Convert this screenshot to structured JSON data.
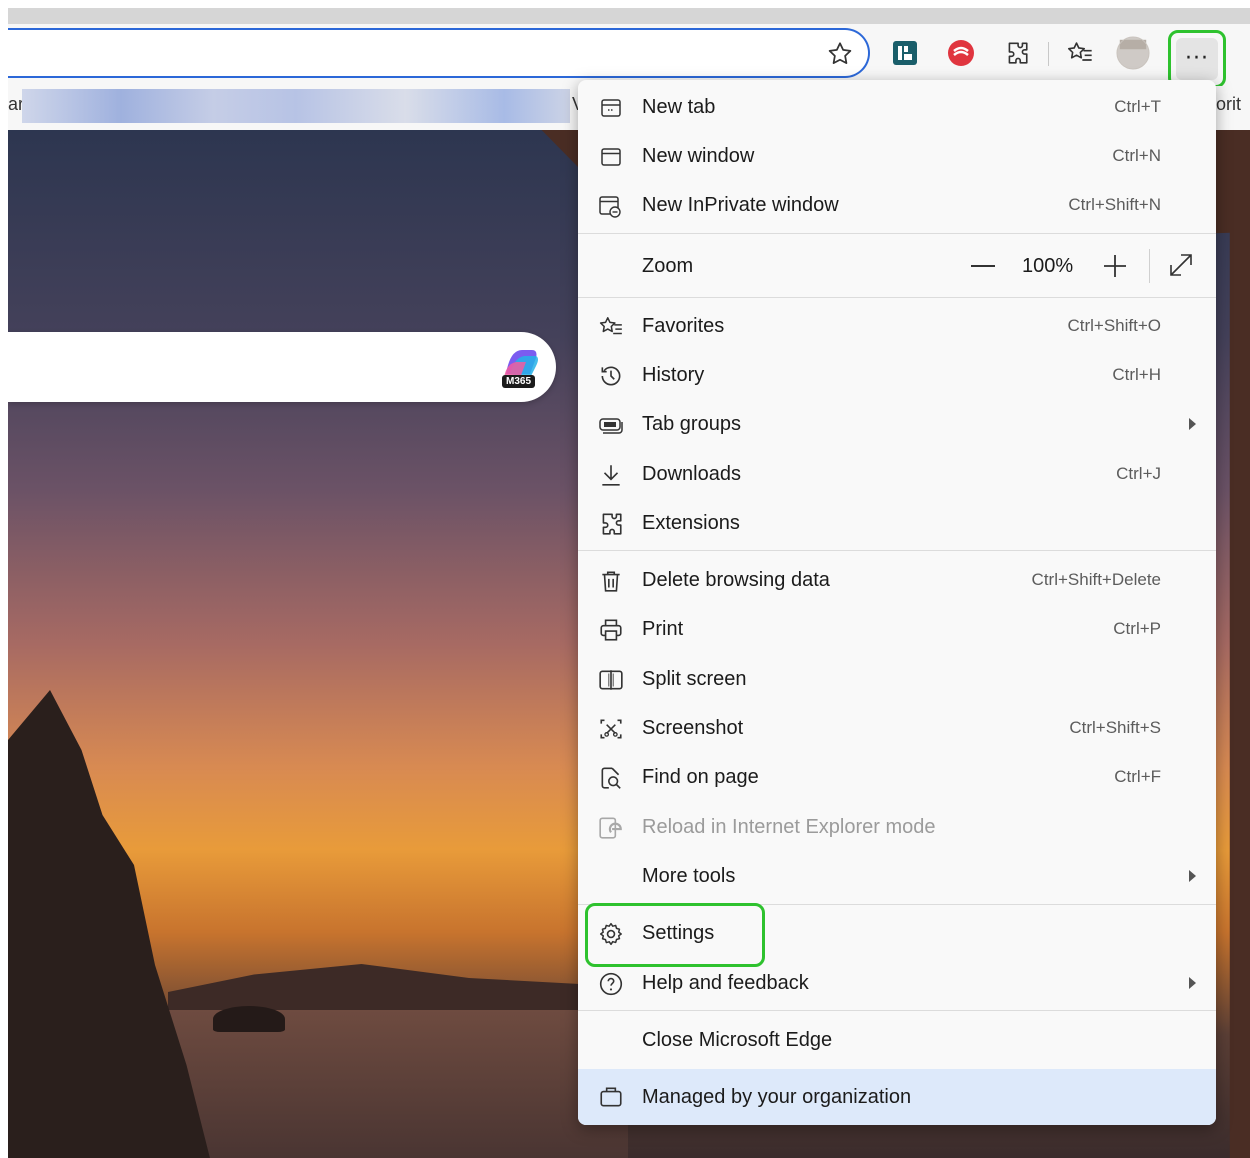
{
  "bookmarks": {
    "left_fragment": "ar",
    "mid_fragment": "V",
    "right_fragment": "orit"
  },
  "page": {
    "search_badge": "M365"
  },
  "menu": {
    "items": [
      {
        "label": "New tab",
        "shortcut": "Ctrl+T",
        "icon": "new-tab-icon"
      },
      {
        "label": "New window",
        "shortcut": "Ctrl+N",
        "icon": "new-window-icon"
      },
      {
        "label": "New InPrivate window",
        "shortcut": "Ctrl+Shift+N",
        "icon": "inprivate-icon"
      },
      {
        "label": "Favorites",
        "shortcut": "Ctrl+Shift+O",
        "icon": "favorites-icon"
      },
      {
        "label": "History",
        "shortcut": "Ctrl+H",
        "icon": "history-icon"
      },
      {
        "label": "Tab groups",
        "shortcut": "",
        "icon": "tab-groups-icon"
      },
      {
        "label": "Downloads",
        "shortcut": "Ctrl+J",
        "icon": "downloads-icon"
      },
      {
        "label": "Extensions",
        "shortcut": "",
        "icon": "extensions-icon"
      },
      {
        "label": "Delete browsing data",
        "shortcut": "Ctrl+Shift+Delete",
        "icon": "trash-icon"
      },
      {
        "label": "Print",
        "shortcut": "Ctrl+P",
        "icon": "print-icon"
      },
      {
        "label": "Split screen",
        "shortcut": "",
        "icon": "split-screen-icon"
      },
      {
        "label": "Screenshot",
        "shortcut": "Ctrl+Shift+S",
        "icon": "screenshot-icon"
      },
      {
        "label": "Find on page",
        "shortcut": "Ctrl+F",
        "icon": "find-icon"
      },
      {
        "label": "Reload in Internet Explorer mode",
        "shortcut": "",
        "icon": "ie-mode-icon"
      },
      {
        "label": "More tools",
        "shortcut": "",
        "icon": ""
      },
      {
        "label": "Settings",
        "shortcut": "",
        "icon": "gear-icon"
      },
      {
        "label": "Help and feedback",
        "shortcut": "",
        "icon": "help-icon"
      },
      {
        "label": "Close Microsoft Edge",
        "shortcut": "",
        "icon": ""
      },
      {
        "label": "Managed by your organization",
        "shortcut": "",
        "icon": "briefcase-icon"
      }
    ],
    "zoom": {
      "label": "Zoom",
      "value": "100%"
    }
  },
  "colors": {
    "highlight_green": "#2ec22e",
    "address_border": "#2c68d8",
    "managed_bg": "#dde9fa"
  }
}
